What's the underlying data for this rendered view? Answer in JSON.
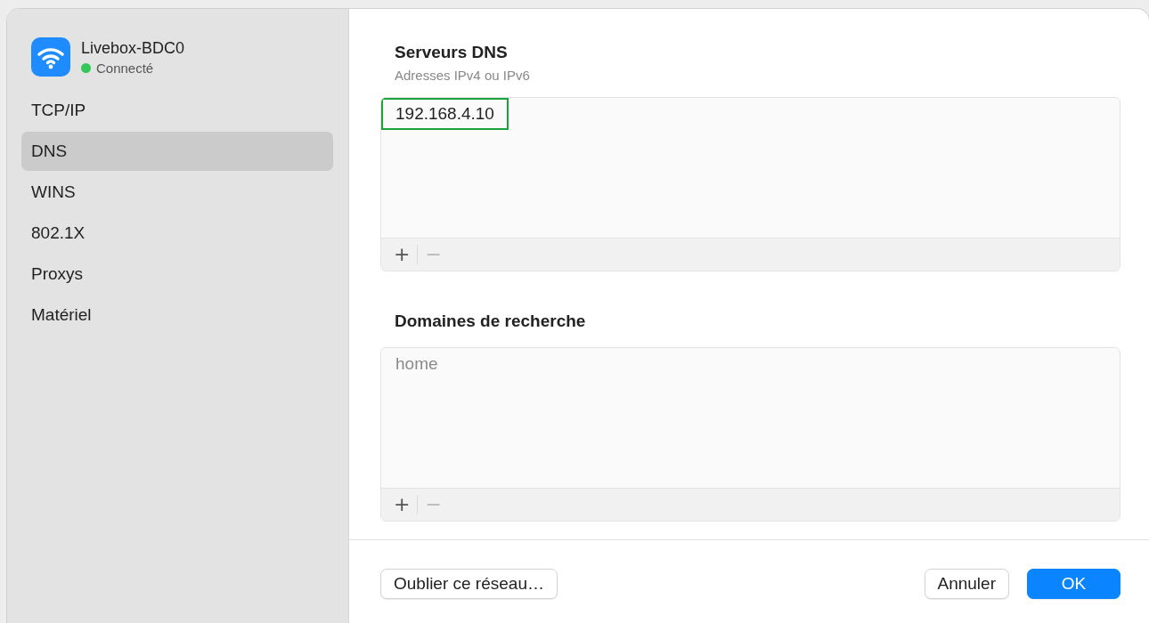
{
  "network": {
    "name": "Livebox-BDC0",
    "status": "Connecté",
    "connected": true
  },
  "sidebar": {
    "items": [
      {
        "label": "TCP/IP",
        "selected": false
      },
      {
        "label": "DNS",
        "selected": true
      },
      {
        "label": "WINS",
        "selected": false
      },
      {
        "label": "802.1X",
        "selected": false
      },
      {
        "label": "Proxys",
        "selected": false
      },
      {
        "label": "Matériel",
        "selected": false
      }
    ]
  },
  "dns_servers": {
    "title": "Serveurs DNS",
    "subtitle": "Adresses IPv4 ou IPv6",
    "entries": [
      {
        "text": "192.168.4.10",
        "highlighted": true
      }
    ],
    "add": {
      "label": "+",
      "disabled": false
    },
    "remove": {
      "label": "−",
      "disabled": true
    }
  },
  "search_domains": {
    "title": "Domaines de recherche",
    "entries": [
      {
        "text": "home",
        "highlighted": false,
        "dimmed": true
      }
    ],
    "add": {
      "label": "+",
      "disabled": false
    },
    "remove": {
      "label": "−",
      "disabled": true
    }
  },
  "buttons": [
    {
      "label": "Oublier ce réseau…",
      "kind": "secondary"
    },
    {
      "label": "Annuler",
      "kind": "secondary"
    },
    {
      "label": "OK",
      "kind": "primary"
    }
  ]
}
